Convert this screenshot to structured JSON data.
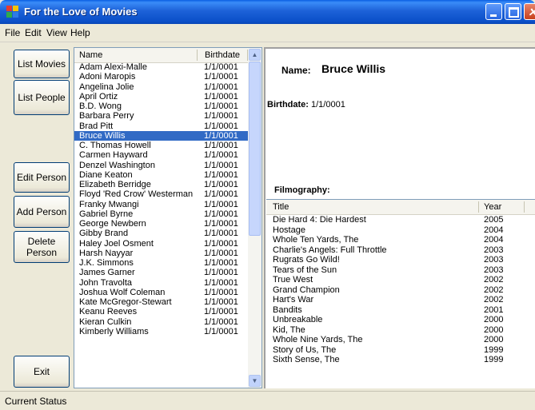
{
  "window": {
    "title": "For the Love of Movies"
  },
  "menu": [
    "File",
    "Edit",
    "View",
    "Help"
  ],
  "buttons": {
    "list_movies": "List Movies",
    "list_people": "List People",
    "edit_person": "Edit Person",
    "add_person": "Add Person",
    "delete_person": "Delete Person",
    "exit": "Exit"
  },
  "people_list": {
    "columns": [
      "Name",
      "Birthdate"
    ],
    "selected": "Bruce Willis",
    "rows": [
      [
        "Adam Alexi-Malle",
        "1/1/0001"
      ],
      [
        "Adoni Maropis",
        "1/1/0001"
      ],
      [
        "Angelina Jolie",
        "1/1/0001"
      ],
      [
        "April Ortiz",
        "1/1/0001"
      ],
      [
        "B.D. Wong",
        "1/1/0001"
      ],
      [
        "Barbara Perry",
        "1/1/0001"
      ],
      [
        "Brad Pitt",
        "1/1/0001"
      ],
      [
        "Bruce Willis",
        "1/1/0001"
      ],
      [
        "C. Thomas Howell",
        "1/1/0001"
      ],
      [
        "Carmen Hayward",
        "1/1/0001"
      ],
      [
        "Denzel Washington",
        "1/1/0001"
      ],
      [
        "Diane Keaton",
        "1/1/0001"
      ],
      [
        "Elizabeth Berridge",
        "1/1/0001"
      ],
      [
        "Floyd 'Red Crow' Westerman",
        "1/1/0001"
      ],
      [
        "Franky Mwangi",
        "1/1/0001"
      ],
      [
        "Gabriel Byrne",
        "1/1/0001"
      ],
      [
        "George Newbern",
        "1/1/0001"
      ],
      [
        "Gibby Brand",
        "1/1/0001"
      ],
      [
        "Haley Joel Osment",
        "1/1/0001"
      ],
      [
        "Harsh Nayyar",
        "1/1/0001"
      ],
      [
        "J.K. Simmons",
        "1/1/0001"
      ],
      [
        "James Garner",
        "1/1/0001"
      ],
      [
        "John Travolta",
        "1/1/0001"
      ],
      [
        "Joshua Wolf Coleman",
        "1/1/0001"
      ],
      [
        "Kate McGregor-Stewart",
        "1/1/0001"
      ],
      [
        "Keanu Reeves",
        "1/1/0001"
      ],
      [
        "Kieran Culkin",
        "1/1/0001"
      ],
      [
        "Kimberly Williams",
        "1/1/0001"
      ]
    ]
  },
  "detail": {
    "name_label": "Name:",
    "name_value": "Bruce Willis",
    "birthdate_label": "Birthdate:",
    "birthdate_value": "1/1/0001",
    "filmography_label": "Filmography:"
  },
  "filmography": {
    "columns": [
      "Title",
      "Year"
    ],
    "rows": [
      [
        "Die Hard 4: Die Hardest",
        "2005"
      ],
      [
        "Hostage",
        "2004"
      ],
      [
        "Whole Ten Yards, The",
        "2004"
      ],
      [
        "Charlie's Angels: Full Throttle",
        "2003"
      ],
      [
        "Rugrats Go Wild!",
        "2003"
      ],
      [
        "Tears of the Sun",
        "2003"
      ],
      [
        "True West",
        "2002"
      ],
      [
        "Grand Champion",
        "2002"
      ],
      [
        "Hart's War",
        "2002"
      ],
      [
        "Bandits",
        "2001"
      ],
      [
        "Unbreakable",
        "2000"
      ],
      [
        "Kid, The",
        "2000"
      ],
      [
        "Whole Nine Yards, The",
        "2000"
      ],
      [
        "Story of Us, The",
        "1999"
      ],
      [
        "Sixth Sense, The",
        "1999"
      ]
    ]
  },
  "status": {
    "text": "Current Status"
  },
  "colors": {
    "title_bar": "#0a4fc8",
    "selection": "#316ac5",
    "window_bg": "#ece9d8"
  }
}
